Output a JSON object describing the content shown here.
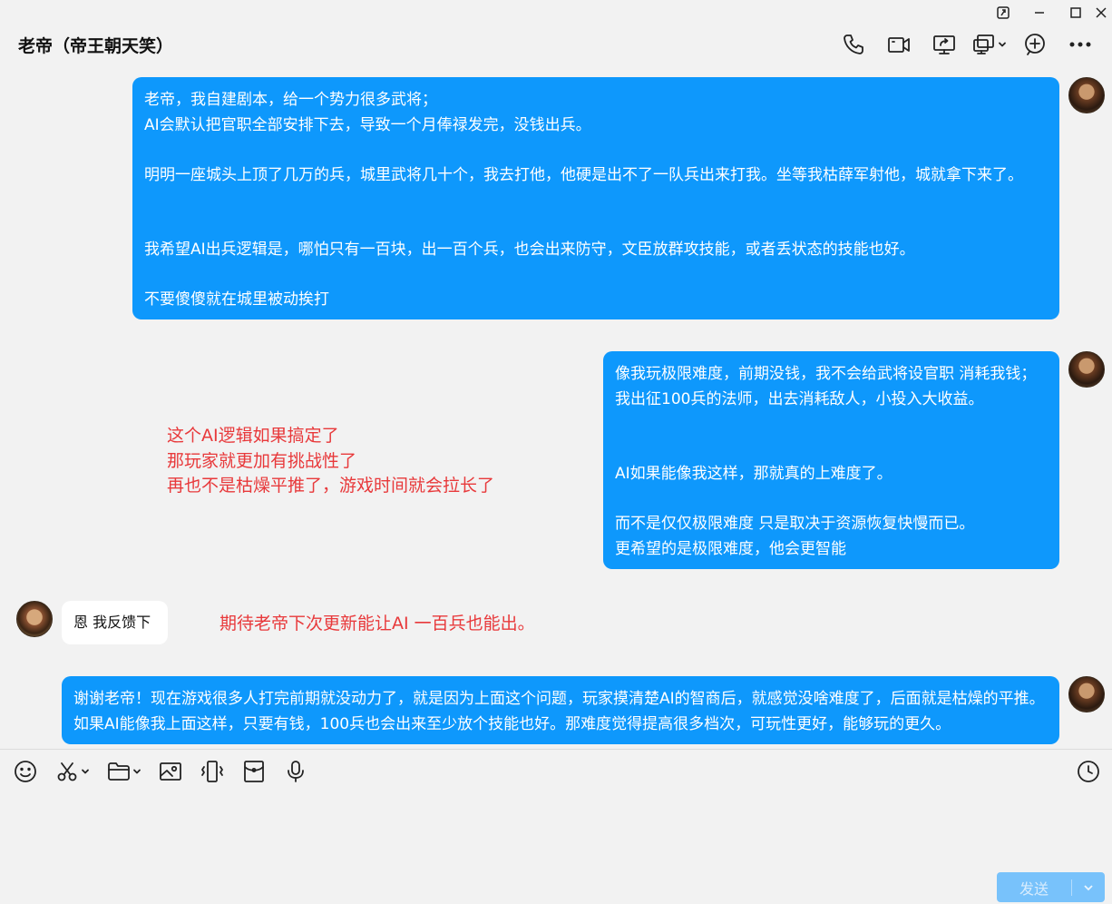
{
  "window": {
    "controls": [
      "pin-icon",
      "minimize-icon",
      "maximize-icon",
      "close-icon"
    ]
  },
  "header": {
    "title": "老帝（帝王朝天笑）",
    "icons": [
      "phone-icon",
      "video-icon",
      "screen-share-icon",
      "remote-desktop-icon",
      "add-member-icon",
      "more-icon"
    ]
  },
  "messages": [
    {
      "sender": "me",
      "text": "老帝，我自建剧本，给一个势力很多武将；\nAI会默认把官职全部安排下去，导致一个月俸禄发完，没钱出兵。\n\n明明一座城头上顶了几万的兵，城里武将几十个，我去打他，他硬是出不了一队兵出来打我。坐等我枯薛军射他，城就拿下来了。\n\n\n我希望AI出兵逻辑是，哪怕只有一百块，出一百个兵，也会出来防守，文臣放群攻技能，或者丢状态的技能也好。\n\n不要傻傻就在城里被动挨打"
    },
    {
      "sender": "me",
      "text": "像我玩极限难度，前期没钱，我不会给武将设官职 消耗我钱；\n我出征100兵的法师，出去消耗敌人，小投入大收益。\n\n\nAI如果能像我这样，那就真的上难度了。\n\n而不是仅仅极限难度 只是取决于资源恢复快慢而已。\n更希望的是极限难度，他会更智能"
    },
    {
      "sender": "them",
      "text": "恩 我反馈下"
    },
    {
      "sender": "me",
      "text": "谢谢老帝！现在游戏很多人打完前期就没动力了，就是因为上面这个问题，玩家摸清楚AI的智商后，就感觉没啥难度了，后面就是枯燥的平推。如果AI能像我上面这样，只要有钱，100兵也会出来至少放个技能也好。那难度觉得提高很多档次，可玩性更好，能够玩的更久。"
    }
  ],
  "annotations": [
    "这个AI逻辑如果搞定了\n那玩家就更加有挑战性了\n再也不是枯燥平推了，游戏时间就会拉长了",
    "期待老帝下次更新能让AI 一百兵也能出。"
  ],
  "toolbar": {
    "tools": [
      "emoji-icon",
      "screenshot-scissors-icon",
      "folder-icon",
      "image-icon",
      "shake-icon",
      "red-packet-icon",
      "voice-mic-icon"
    ],
    "history": "history-clock-icon"
  },
  "input": {
    "value": ""
  },
  "send": {
    "label": "发送",
    "dropdown": "chevron-down-icon",
    "accent": "#78c2fb"
  },
  "colors": {
    "bubble_me": "#0e98fc",
    "bubble_them": "#ffffff",
    "annotation": "#e8393b",
    "background": "#f2f2f2"
  }
}
